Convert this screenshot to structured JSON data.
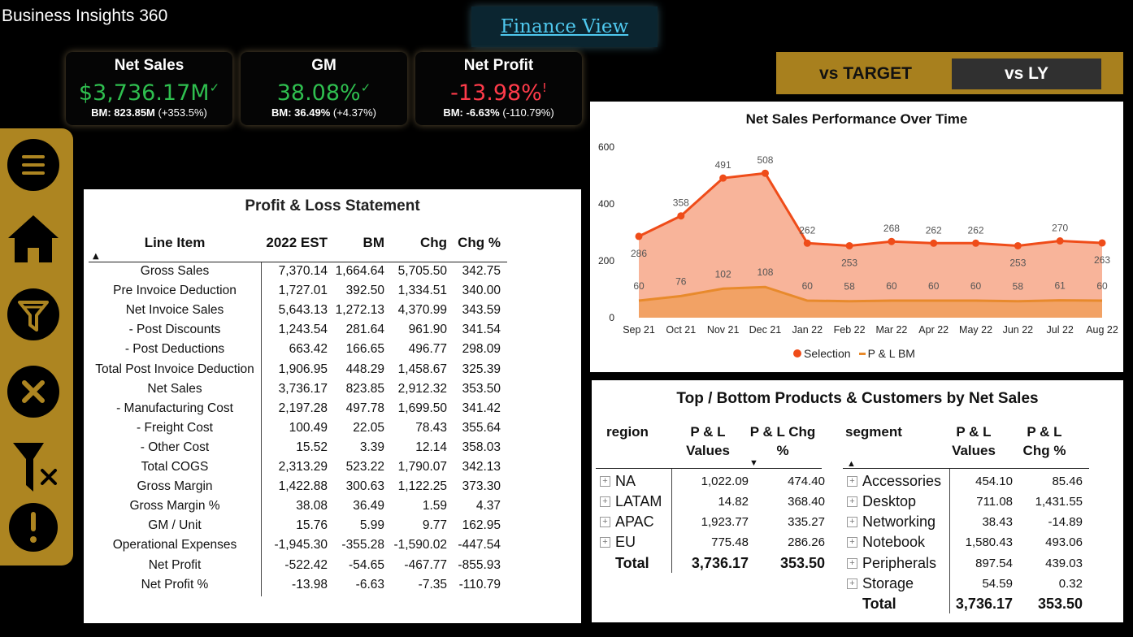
{
  "app": {
    "title": "Business Insights 360",
    "view_link": "Finance View"
  },
  "kpis": [
    {
      "title": "Net Sales",
      "value": "$3,736.17M",
      "status": "✓",
      "bm_label": "BM: 823.85M",
      "bm_change": "(+353.5%)"
    },
    {
      "title": "GM",
      "value": "38.08%",
      "status": "✓",
      "bm_label": "BM: 36.49%",
      "bm_change": "(+4.37%)"
    },
    {
      "title": "Net Profit",
      "value": "-13.98%",
      "status": "!",
      "bm_label": "BM: -6.63%",
      "bm_change": "(-110.79%)"
    }
  ],
  "toggle": {
    "options": [
      "vs TARGET",
      "vs LY"
    ],
    "selected": "vs LY"
  },
  "sidebar": {
    "icons": [
      "menu-icon",
      "home-icon",
      "filter-icon",
      "close-icon",
      "clear-filter-icon",
      "info-icon"
    ]
  },
  "pl": {
    "title": "Profit & Loss Statement",
    "columns": [
      "Line Item",
      "2022 EST",
      "BM",
      "Chg",
      "Chg %"
    ],
    "rows": [
      [
        "Gross Sales",
        "7,370.14",
        "1,664.64",
        "5,705.50",
        "342.75"
      ],
      [
        "Pre Invoice Deduction",
        "1,727.01",
        "392.50",
        "1,334.51",
        "340.00"
      ],
      [
        "Net Invoice Sales",
        "5,643.13",
        "1,272.13",
        "4,370.99",
        "343.59"
      ],
      [
        "- Post Discounts",
        "1,243.54",
        "281.64",
        "961.90",
        "341.54"
      ],
      [
        "- Post Deductions",
        "663.42",
        "166.65",
        "496.77",
        "298.09"
      ],
      [
        "Total Post Invoice Deduction",
        "1,906.95",
        "448.29",
        "1,458.67",
        "325.39"
      ],
      [
        "Net Sales",
        "3,736.17",
        "823.85",
        "2,912.32",
        "353.50"
      ],
      [
        "- Manufacturing Cost",
        "2,197.28",
        "497.78",
        "1,699.50",
        "341.42"
      ],
      [
        "- Freight Cost",
        "100.49",
        "22.05",
        "78.43",
        "355.64"
      ],
      [
        "- Other Cost",
        "15.52",
        "3.39",
        "12.14",
        "358.03"
      ],
      [
        "Total COGS",
        "2,313.29",
        "523.22",
        "1,790.07",
        "342.13"
      ],
      [
        "Gross Margin",
        "1,422.88",
        "300.63",
        "1,122.25",
        "373.30"
      ],
      [
        "Gross Margin %",
        "38.08",
        "36.49",
        "1.59",
        "4.37"
      ],
      [
        "GM / Unit",
        "15.76",
        "5.99",
        "9.77",
        "162.95"
      ],
      [
        "Operational Expenses",
        "-1,945.30",
        "-355.28",
        "-1,590.02",
        "-447.54"
      ],
      [
        "Net Profit",
        "-522.42",
        "-54.65",
        "-467.77",
        "-855.93"
      ],
      [
        "Net Profit %",
        "-13.98",
        "-6.63",
        "-7.35",
        "-110.79"
      ]
    ]
  },
  "chart_data": {
    "type": "area",
    "title": "Net Sales Performance Over Time",
    "categories": [
      "Sep 21",
      "Oct 21",
      "Nov 21",
      "Dec 21",
      "Jan 22",
      "Feb 22",
      "Mar 22",
      "Apr 22",
      "May 22",
      "Jun 22",
      "Jul 22",
      "Aug 22"
    ],
    "series": [
      {
        "name": "Selection",
        "color": "#ef4c19",
        "values": [
          286,
          358,
          491,
          508,
          262,
          253,
          268,
          262,
          262,
          253,
          270,
          263
        ]
      },
      {
        "name": "P & L BM",
        "color": "#e88a2c",
        "values": [
          60,
          76,
          102,
          108,
          60,
          58,
          60,
          60,
          60,
          58,
          61,
          60
        ]
      }
    ],
    "yticks": [
      0,
      200,
      400,
      600
    ],
    "ylim": [
      0,
      600
    ],
    "legend": "bottom"
  },
  "topbottom": {
    "title": "Top / Bottom Products & Customers by Net Sales",
    "region_header": "region",
    "values_header": "P & L Values",
    "chg_header": "P & L Chg %",
    "region_rows": [
      [
        "NA",
        "1,022.09",
        "474.40"
      ],
      [
        "LATAM",
        "14.82",
        "368.40"
      ],
      [
        "APAC",
        "1,923.77",
        "335.27"
      ],
      [
        "EU",
        "775.48",
        "286.26"
      ]
    ],
    "region_total": [
      "Total",
      "3,736.17",
      "353.50"
    ],
    "segment_header": "segment",
    "segment_rows": [
      [
        "Accessories",
        "454.10",
        "85.46"
      ],
      [
        "Desktop",
        "711.08",
        "1,431.55"
      ],
      [
        "Networking",
        "38.43",
        "-14.89"
      ],
      [
        "Notebook",
        "1,580.43",
        "493.06"
      ],
      [
        "Peripherals",
        "897.54",
        "439.03"
      ],
      [
        "Storage",
        "54.59",
        "0.32"
      ]
    ],
    "segment_total": [
      "Total",
      "3,736.17",
      "353.50"
    ]
  }
}
